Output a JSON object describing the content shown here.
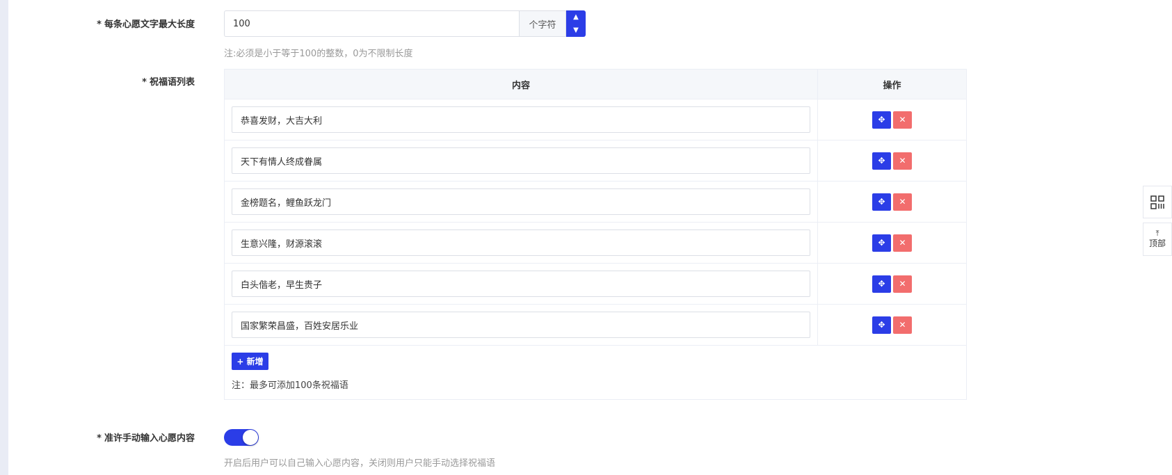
{
  "max_length": {
    "label": "每条心愿文字最大长度",
    "value": "100",
    "unit": "个字符",
    "tip": "注:必须是小于等于100的整数，0为不限制长度"
  },
  "blessings": {
    "label": "祝福语列表",
    "header_content": "内容",
    "header_ops": "操作",
    "rows": [
      "恭喜发财，大吉大利",
      "天下有情人终成眷属",
      "金榜题名，鲤鱼跃龙门",
      "生意兴隆，财源滚滚",
      "白头偕老，早生贵子",
      "国家繁荣昌盛，百姓安居乐业"
    ],
    "add_label": "+ 新增",
    "note": "注：最多可添加100条祝福语"
  },
  "manual_input": {
    "label": "准许手动输入心愿内容",
    "enabled": true,
    "tip": "开启后用户可以自己输入心愿内容，关闭则用户只能手动选择祝福语"
  },
  "float": {
    "top_label": "顶部"
  },
  "colors": {
    "primary": "#2b3de7",
    "danger": "#f26d6d"
  }
}
